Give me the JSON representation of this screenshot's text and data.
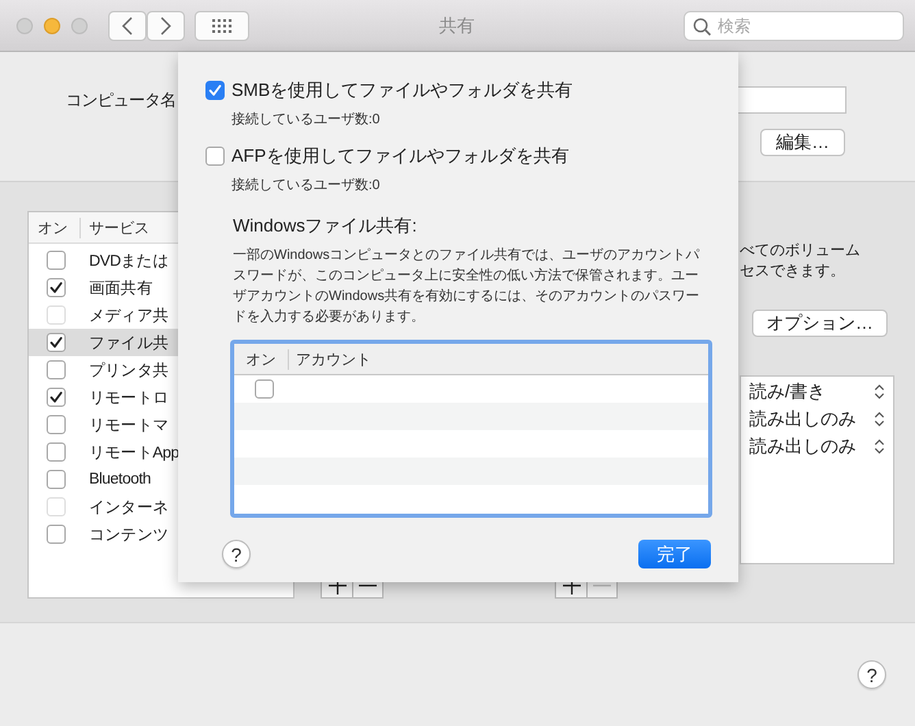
{
  "window": {
    "title": "共有",
    "search": {
      "placeholder": "検索"
    }
  },
  "computer_name": {
    "label": "コンピュータ名",
    "edit_button": "編集…"
  },
  "services": {
    "columns": [
      "オン",
      "サービス"
    ],
    "items": [
      {
        "label": "DVDまたは",
        "checked": false,
        "disabled": false,
        "selected": false
      },
      {
        "label": "画面共有",
        "checked": true,
        "disabled": false,
        "selected": false
      },
      {
        "label": "メディア共",
        "checked": false,
        "disabled": true,
        "selected": false
      },
      {
        "label": "ファイル共",
        "checked": true,
        "disabled": false,
        "selected": true
      },
      {
        "label": "プリンタ共",
        "checked": false,
        "disabled": false,
        "selected": false
      },
      {
        "label": "リモートロ",
        "checked": true,
        "disabled": false,
        "selected": false
      },
      {
        "label": "リモートマ",
        "checked": false,
        "disabled": false,
        "selected": false
      },
      {
        "label": "リモートApp",
        "checked": false,
        "disabled": false,
        "selected": false
      },
      {
        "label": "Bluetooth",
        "checked": false,
        "disabled": false,
        "selected": false
      },
      {
        "label": "インターネ",
        "checked": false,
        "disabled": true,
        "selected": false
      },
      {
        "label": "コンテンツ",
        "checked": false,
        "disabled": false,
        "selected": false
      }
    ]
  },
  "add_remove_buttons": [
    {
      "remove_disabled": false
    },
    {
      "remove_disabled": true
    }
  ],
  "info_text": [
    "べてのボリューム",
    "セスできます。"
  ],
  "options_button": "オプション…",
  "permissions": [
    "読み/書き",
    "読み出しのみ",
    "読み出しのみ"
  ],
  "help_label": "?",
  "sheet": {
    "options": [
      {
        "label": "SMBを使用してファイルやフォルダを共有",
        "checked": true,
        "status": "接続しているユーザ数:0"
      },
      {
        "label": "AFPを使用してファイルやフォルダを共有",
        "checked": false,
        "status": "接続しているユーザ数:0"
      }
    ],
    "windows_heading": "Windowsファイル共有:",
    "windows_note": "一部のWindowsコンピュータとのファイル共有では、ユーザのアカウントパスワードが、このコンピュータ上に安全性の低い方法で保管されます。ユーザアカウントのWindows共有を有効にするには、そのアカウントのパスワードを入力する必要があります。",
    "accounts": {
      "columns": [
        "オン",
        "アカウント"
      ],
      "rows": [
        {
          "checked": false
        }
      ]
    },
    "help_label": "?",
    "done_button": "完了"
  }
}
